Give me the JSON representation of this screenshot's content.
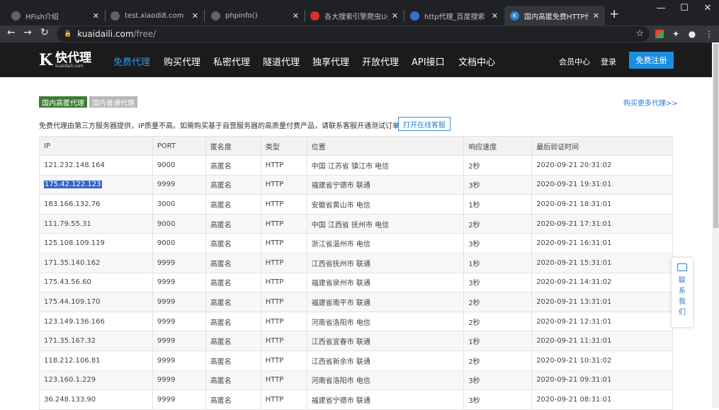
{
  "browser": {
    "tabs": [
      {
        "title": "HFish介绍",
        "fav_color": "#5f6368",
        "fav_char": ""
      },
      {
        "title": "test.xiaodi8.com",
        "fav_color": "#5f6368",
        "fav_char": ""
      },
      {
        "title": "phpinfo()",
        "fav_color": "#5f6368",
        "fav_char": ""
      },
      {
        "title": "各大搜索引擎爬虫User-",
        "fav_color": "#d93025",
        "fav_char": ""
      },
      {
        "title": "http代理_百度搜索",
        "fav_color": "#3b6fd8",
        "fav_char": ""
      },
      {
        "title": "国内高匿免费HTTP代理",
        "fav_color": "#2a7fd4",
        "fav_char": "K"
      }
    ],
    "new_tab": "+",
    "url_host": "kuaidaili.com",
    "url_path": "/free/",
    "win_min": "—",
    "win_max": "☐",
    "win_close": "✕"
  },
  "site": {
    "logo_mark": "K",
    "logo_name": "快代理",
    "logo_sub": "kuaidaili.com",
    "nav": [
      "免费代理",
      "购买代理",
      "私密代理",
      "隧道代理",
      "独享代理",
      "开放代理",
      "API接口",
      "文档中心"
    ],
    "member": "会员中心",
    "login": "登录",
    "register": "免费注册"
  },
  "tags": {
    "anon": "国内高匿代理",
    "normal": "国内普通代理"
  },
  "buy_more": "购买更多代理>>",
  "notice": "免费代理由第三方服务器提供，IP质量不高。如需购买基于自营服务器的高质量付费产品，请联系客服开通测试订单。",
  "chat_button": "打开在线客服",
  "table": {
    "headers": [
      "IP",
      "PORT",
      "匿名度",
      "类型",
      "位置",
      "响应速度",
      "最后验证时间"
    ],
    "rows": [
      [
        "121.232.148.164",
        "9000",
        "高匿名",
        "HTTP",
        "中国 江苏省 镇江市 电信",
        "2秒",
        "2020-09-21 20:31:02"
      ],
      [
        "175.42.122.123",
        "9999",
        "高匿名",
        "HTTP",
        "福建省宁德市 联通",
        "3秒",
        "2020-09-21 19:31:01"
      ],
      [
        "183.166.132.76",
        "3000",
        "高匿名",
        "HTTP",
        "安徽省黄山市 电信",
        "1秒",
        "2020-09-21 18:31:01"
      ],
      [
        "111.79.55.31",
        "9000",
        "高匿名",
        "HTTP",
        "中国 江西省 抚州市 电信",
        "2秒",
        "2020-09-21 17:31:01"
      ],
      [
        "125.108.109.119",
        "9000",
        "高匿名",
        "HTTP",
        "浙江省温州市 电信",
        "3秒",
        "2020-09-21 16:31:01"
      ],
      [
        "171.35.140.162",
        "9999",
        "高匿名",
        "HTTP",
        "江西省抚州市 联通",
        "1秒",
        "2020-09-21 15:31:01"
      ],
      [
        "175.43.56.60",
        "9999",
        "高匿名",
        "HTTP",
        "福建省泉州市 联通",
        "3秒",
        "2020-09-21 14:31:02"
      ],
      [
        "175.44.109.170",
        "9999",
        "高匿名",
        "HTTP",
        "福建省南平市 联通",
        "2秒",
        "2020-09-21 13:31:01"
      ],
      [
        "123.149.136.166",
        "9999",
        "高匿名",
        "HTTP",
        "河南省洛阳市 电信",
        "2秒",
        "2020-09-21 12:31:01"
      ],
      [
        "171.35.167.32",
        "9999",
        "高匿名",
        "HTTP",
        "江西省宜春市 联通",
        "1秒",
        "2020-09-21 11:31:01"
      ],
      [
        "118.212.106.81",
        "9999",
        "高匿名",
        "HTTP",
        "江西省新余市 联通",
        "2秒",
        "2020-09-21 10:31:02"
      ],
      [
        "123.160.1.229",
        "9999",
        "高匿名",
        "HTTP",
        "河南省洛阳市 电信",
        "3秒",
        "2020-09-21 09:31:01"
      ],
      [
        "36.248.133.90",
        "9999",
        "高匿名",
        "HTTP",
        "福建省宁德市 联通",
        "3秒",
        "2020-09-21 08:31:01"
      ]
    ],
    "selected_row": 1
  },
  "contact": {
    "chars": [
      "联",
      "系",
      "我",
      "们"
    ]
  },
  "colors": {
    "accent": "#1a8ee0",
    "nav_bg": "#1b1b1b",
    "tag_green": "#3a7d30"
  }
}
